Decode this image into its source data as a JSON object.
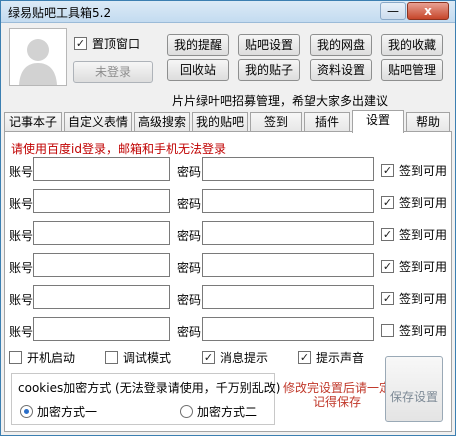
{
  "window": {
    "title": "绿易贴吧工具箱5.2",
    "min_glyph": "—",
    "close_glyph": "x"
  },
  "top": {
    "pin_label": "置顶窗口",
    "pin_checked": true,
    "login_label": "未登录",
    "nav": [
      "我的提醒",
      "贴吧设置",
      "我的网盘",
      "我的收藏",
      "回收站",
      "我的贴子",
      "资料设置",
      "贴吧管理"
    ]
  },
  "notice": "片片绿叶吧招募管理，希望大家多出建议",
  "tabs": [
    "记事本子",
    "自定义表情",
    "高级搜索",
    "我的贴吧",
    "签到",
    "插件",
    "设置",
    "帮助"
  ],
  "active_tab": "设置",
  "settings": {
    "warning": "请使用百度id登录，邮箱和手机无法登录",
    "account_label": "账号",
    "password_label": "密码",
    "signin_label": "签到可用",
    "accounts": [
      {
        "account": "",
        "password": "",
        "signin": true
      },
      {
        "account": "",
        "password": "",
        "signin": true
      },
      {
        "account": "",
        "password": "",
        "signin": true
      },
      {
        "account": "",
        "password": "",
        "signin": true
      },
      {
        "account": "",
        "password": "",
        "signin": true
      },
      {
        "account": "",
        "password": "",
        "signin": false
      }
    ],
    "options": [
      {
        "label": "开机启动",
        "checked": false
      },
      {
        "label": "调试模式",
        "checked": false
      },
      {
        "label": "消息提示",
        "checked": true
      },
      {
        "label": "提示声音",
        "checked": true
      }
    ],
    "cookie_title": "cookies加密方式 (无法登录请使用，千万别乱改)",
    "encrypt_1": "加密方式一",
    "encrypt_2": "加密方式二",
    "encrypt_selected": 1,
    "save_tip": "修改完设置后请一定记得保存",
    "save_button": "保存设置"
  }
}
